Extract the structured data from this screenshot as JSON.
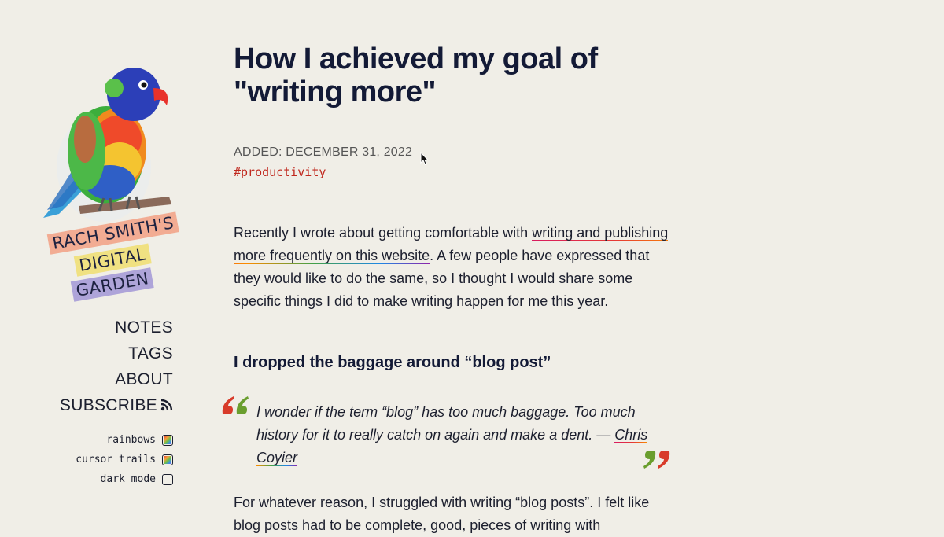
{
  "sidebar": {
    "logo_lines": [
      "RACH SMITH'S",
      "DIGITAL",
      "GARDEN"
    ],
    "nav": [
      {
        "label": "NOTES"
      },
      {
        "label": "TAGS"
      },
      {
        "label": "ABOUT"
      },
      {
        "label": "SUBSCRIBE"
      }
    ],
    "toggles": [
      {
        "label": "rainbows",
        "checked": true
      },
      {
        "label": "cursor trails",
        "checked": true
      },
      {
        "label": "dark mode",
        "checked": false
      }
    ]
  },
  "article": {
    "title": "How I achieved my goal of \"writing more\"",
    "added": "ADDED: DECEMBER 31, 2022",
    "tag": "#productivity",
    "intro_before": "Recently I wrote about getting comfortable with ",
    "intro_link": "writing and publishing more frequently on this website",
    "intro_after": ". A few people have expressed that they would like to do the same, so I thought I would share some specific things I did to make writing happen for me this year.",
    "heading": "I dropped the baggage around “blog post”",
    "quote_text": "I wonder if the term “blog” has too much baggage. Too much history for it to really catch on again and make a dent. — ",
    "quote_author": "Chris Coyier",
    "para2": "For whatever reason, I struggled with writing “blog posts”. I felt like blog posts had to be complete, good, pieces of writing with"
  },
  "colors": {
    "background": "#f0eee7",
    "title": "#131a36",
    "tag": "#c0281e"
  }
}
